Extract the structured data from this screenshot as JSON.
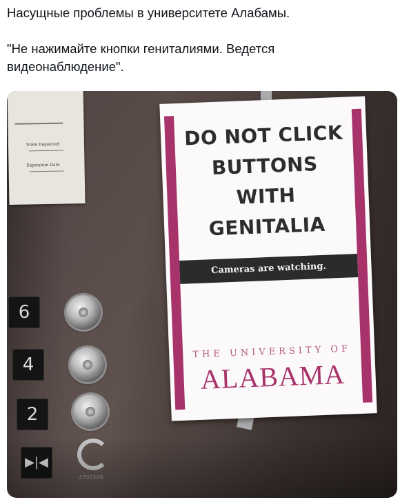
{
  "tweet": {
    "line1": "Насущные проблемы в университете Алабамы.",
    "line2": "\"Не нажимайте кнопки гениталиями. Ведется видеонаблюдение\"."
  },
  "sign": {
    "line1": "DO NOT CLICK",
    "line2": "BUTTONS",
    "line3": "WITH",
    "line4": "GENITALIA",
    "bar": "Cameras are watching.",
    "university": "THE UNIVERSITY OF",
    "name": "ALABAMA"
  },
  "panel": {
    "floors": [
      "6",
      "4",
      "2"
    ],
    "door_icon": "▶|◀",
    "serial": "4701589"
  },
  "inspection_card": {
    "line1": "State Inspected",
    "line2": "Expiration Date"
  },
  "colors": {
    "brand_crimson": "#a8336b",
    "bar_dark": "#2b2b2b",
    "tweet_text": "#0f1419"
  }
}
